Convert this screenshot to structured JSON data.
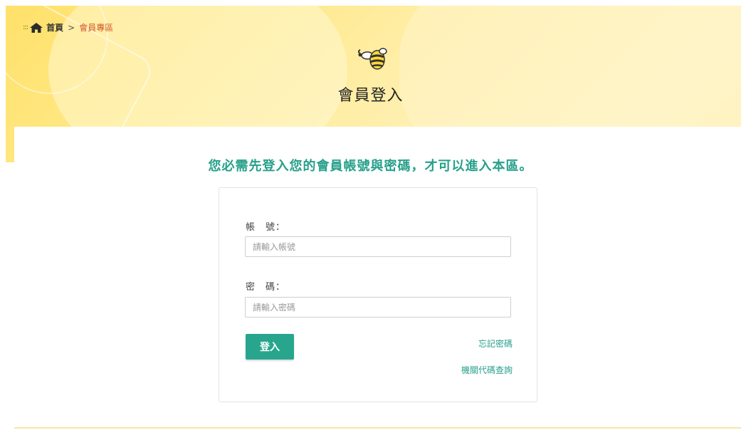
{
  "breadcrumb": {
    "dots": ":::",
    "home": "首頁",
    "separator": ">",
    "current": "會員專區"
  },
  "header": {
    "title": "會員登入"
  },
  "notice": "您必需先登入您的會員帳號與密碼，才可以進入本區。",
  "form": {
    "account_label": "帳　號：",
    "account_placeholder": "請輸入帳號",
    "account_value": "",
    "password_label": "密　碼：",
    "password_placeholder": "請輸入密碼",
    "password_value": "",
    "login_button": "登入",
    "forgot_password": "忘記密碼",
    "agency_code_lookup": "機關代碼查詢"
  },
  "colors": {
    "accent": "#27a68d",
    "breadcrumb_current": "#d4582a",
    "banner": "#ffe16a"
  },
  "icons": {
    "home": "home-icon",
    "logo": "bee-logo-icon"
  }
}
